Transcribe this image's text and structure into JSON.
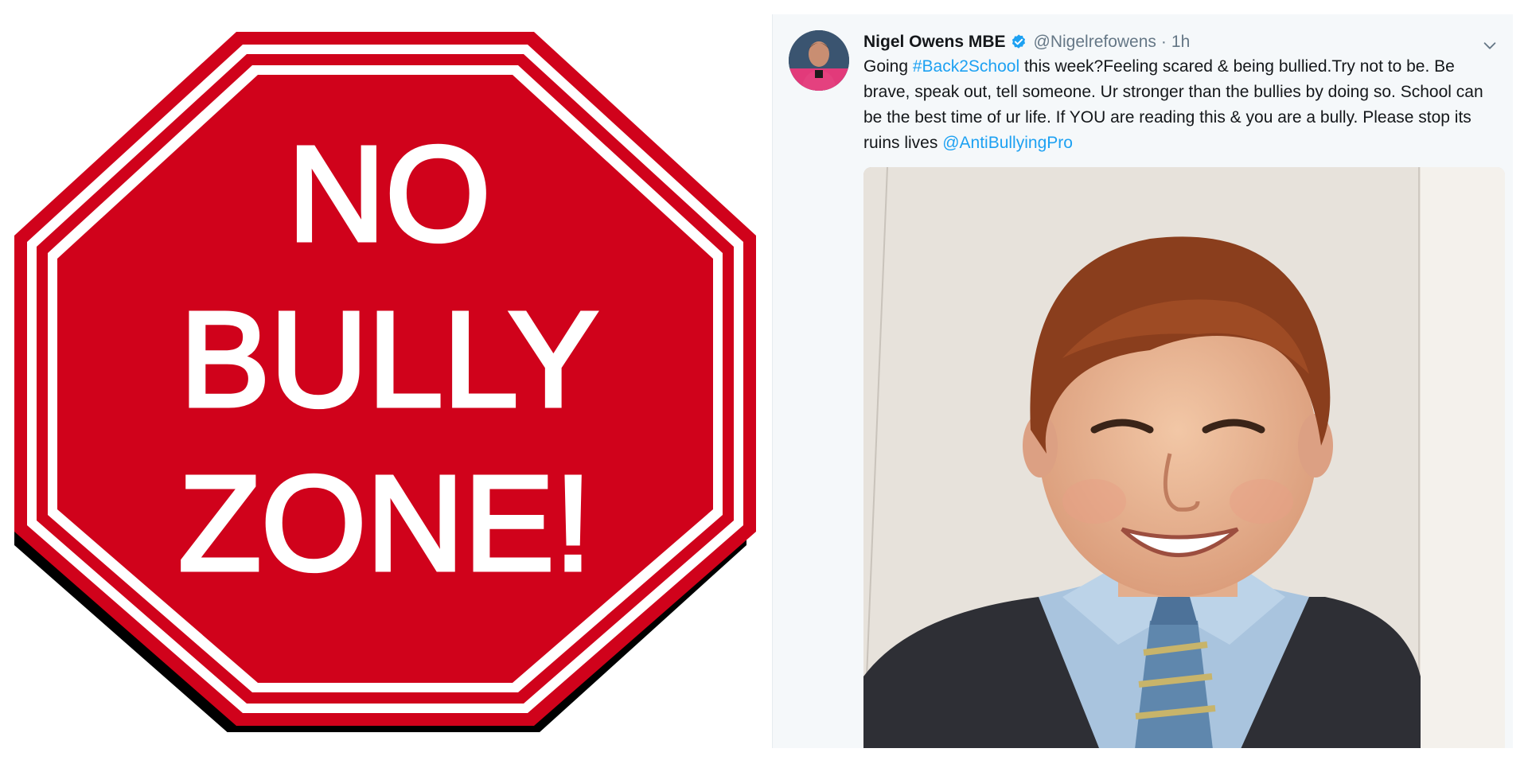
{
  "sign": {
    "line1": "NO",
    "line2": "BULLY",
    "line3": "ZONE!",
    "fill_color": "#d0021b",
    "border_color": "#ffffff"
  },
  "tweet": {
    "display_name": "Nigel Owens MBE",
    "handle": "@Nigelrefowens",
    "separator": "·",
    "timestamp": "1h",
    "body": {
      "pre_hashtag": "Going ",
      "hashtag": "#Back2School",
      "main": " this week?Feeling scared & being bullied.Try not to be. Be brave, speak out, tell someone. Ur stronger than the bullies by doing so. School can be the best time of ur life. If YOU are  reading this & you are a bully. Please stop its ruins lives ",
      "mention": "@AntiBullyingPro"
    },
    "icons": {
      "verified": "verified-badge-icon",
      "more": "chevron-down-icon"
    },
    "link_color": "#1da1f2",
    "verified_color": "#1da1f2"
  }
}
